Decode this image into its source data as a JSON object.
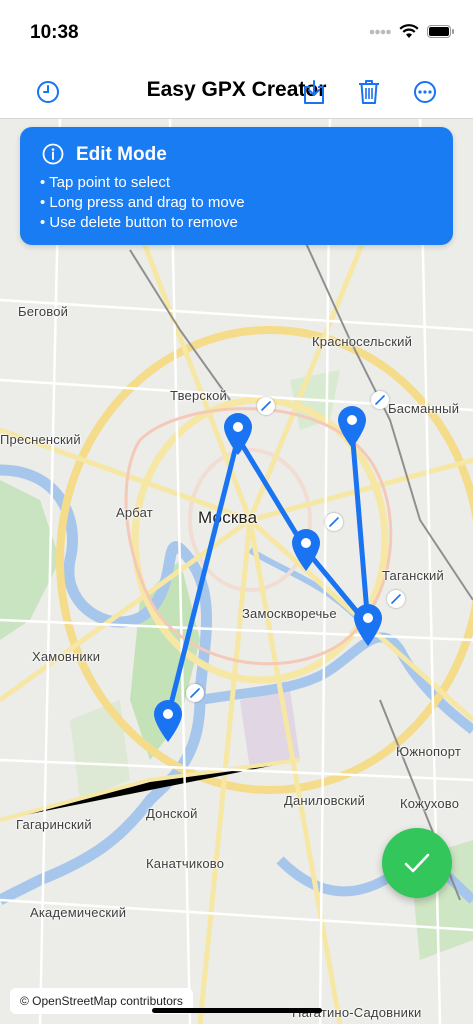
{
  "status": {
    "time": "10:38"
  },
  "nav": {
    "title": "Easy GPX Creator",
    "left_icon": "clock-icon",
    "right_icons": [
      "download-icon",
      "trash-icon",
      "more-icon"
    ]
  },
  "banner": {
    "icon": "info-icon",
    "title": "Edit Mode",
    "items": [
      "Tap point to select",
      "Long press and drag to move",
      "Use delete button to remove"
    ]
  },
  "map": {
    "labels": {
      "begovoy": "Беговой",
      "krasnoselsky": "Красносельский",
      "tverskoy": "Тверской",
      "basmanny": "Басманный",
      "presnensky": "Пресненский",
      "arbat": "Арбат",
      "moskva": "Москва",
      "tagansky": "Таганский",
      "zamoskvorechye": "Замоскворечье",
      "khamovniki": "Хамовники",
      "yuzhnoport": "Южнопорт",
      "danilovsky": "Даниловский",
      "kozhukhovo": "Кожухово",
      "donskoy": "Донской",
      "gagarinsky": "Гагаринский",
      "kanatchikovo": "Канатчиково",
      "akademichesky": "Академический",
      "nagatino": "Нагатино-Садовники"
    },
    "route_color": "#1a73f0"
  },
  "attribution": "© OpenStreetMap contributors",
  "confirm": {
    "icon": "checkmark-icon",
    "color": "#33c65a"
  }
}
